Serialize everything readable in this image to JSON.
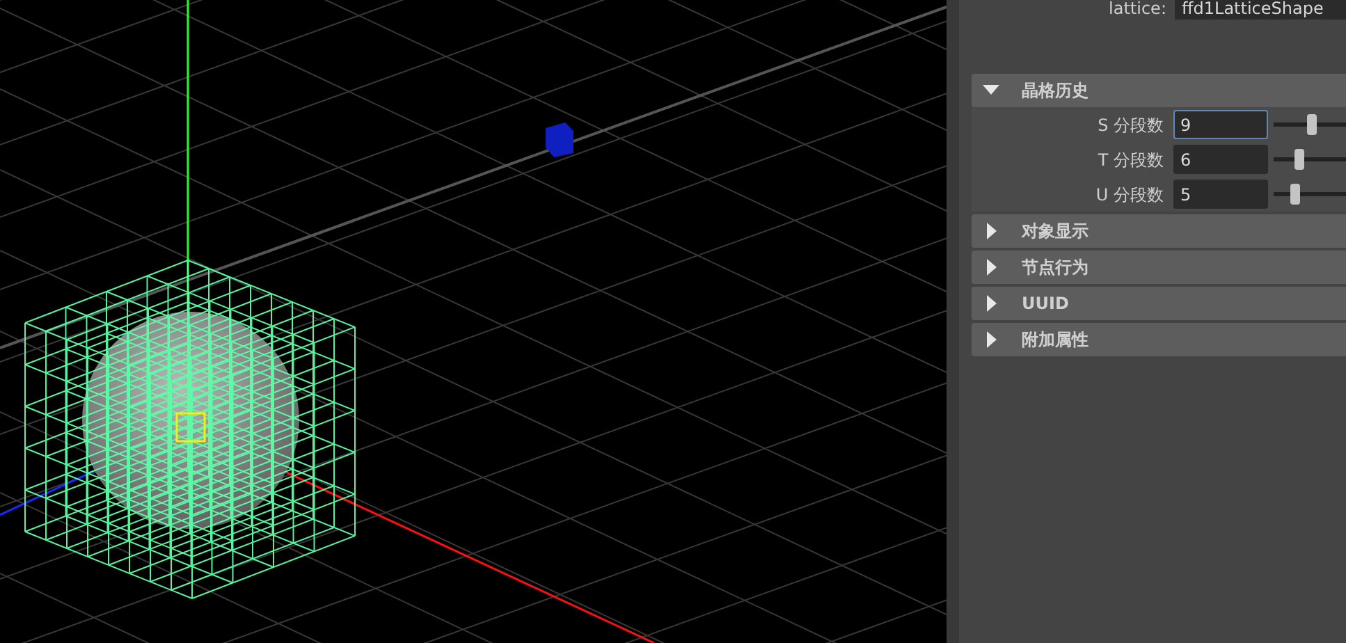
{
  "lattice_field": {
    "label": "lattice:",
    "value": "ffd1LatticeShape"
  },
  "sections": [
    {
      "title": "晶格历史",
      "expanded": true,
      "fields": [
        {
          "label": "S 分段数",
          "value": "9",
          "focused": true,
          "level": 0.3
        },
        {
          "label": "T 分段数",
          "value": "6",
          "focused": false,
          "level": 0.2
        },
        {
          "label": "U 分段数",
          "value": "5",
          "focused": false,
          "level": 0.17
        }
      ]
    },
    {
      "title": "对象显示",
      "expanded": false
    },
    {
      "title": "节点行为",
      "expanded": false
    },
    {
      "title": "UUID",
      "expanded": false
    },
    {
      "title": "附加属性",
      "expanded": false
    }
  ]
}
